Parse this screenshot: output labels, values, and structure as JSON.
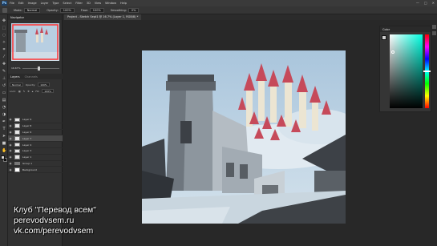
{
  "menubar": {
    "logo": "Ps",
    "items": [
      "File",
      "Edit",
      "Image",
      "Layer",
      "Type",
      "Select",
      "Filter",
      "3D",
      "View",
      "Window",
      "Help"
    ],
    "window_controls": [
      "—",
      "□",
      "✕"
    ]
  },
  "options": {
    "mode_label": "Mode:",
    "mode_value": "Normal",
    "opacity_label": "Opacity:",
    "opacity_value": "100%",
    "flow_label": "Flow:",
    "flow_value": "100%",
    "smoothing_label": "Smoothing:",
    "smoothing_value": "0%"
  },
  "document": {
    "tab_title": "Project - Sketch Sept1 @ 16.7% (Layer 1, RGB/8) *"
  },
  "navigator": {
    "title": "Navigator",
    "zoom": "16.67%"
  },
  "layers": {
    "tabs": [
      "Layers",
      "Channels"
    ],
    "blend_mode": "Normal",
    "opacity_label": "Opacity:",
    "opacity_value": "100%",
    "lock_label": "Lock:",
    "fill_label": "Fill:",
    "fill_value": "100%",
    "items": [
      {
        "name": "Layer 9",
        "type": "layer",
        "active": false
      },
      {
        "name": "Layer 8",
        "type": "layer",
        "active": false
      },
      {
        "name": "Layer 6",
        "type": "layer",
        "active": false
      },
      {
        "name": "Layer 7",
        "type": "layer",
        "active": true
      },
      {
        "name": "Layer 4",
        "type": "layer",
        "active": false
      },
      {
        "name": "Layer 3",
        "type": "layer",
        "active": false
      },
      {
        "name": "Layer 1",
        "type": "layer",
        "active": false
      },
      {
        "name": "Group 1",
        "type": "group",
        "active": false
      },
      {
        "name": "Background",
        "type": "background",
        "active": false
      }
    ]
  },
  "color_panel": {
    "title": "Color",
    "hue_color": "#00ffe1"
  },
  "watermark": {
    "line1": "Клуб \"Перевод всем\"",
    "line2": "perevodvsem.ru",
    "line3": "vk.com/perevodvsem"
  },
  "colors": {
    "accent": "#c64a5a",
    "sky": "#b7cfe0"
  }
}
